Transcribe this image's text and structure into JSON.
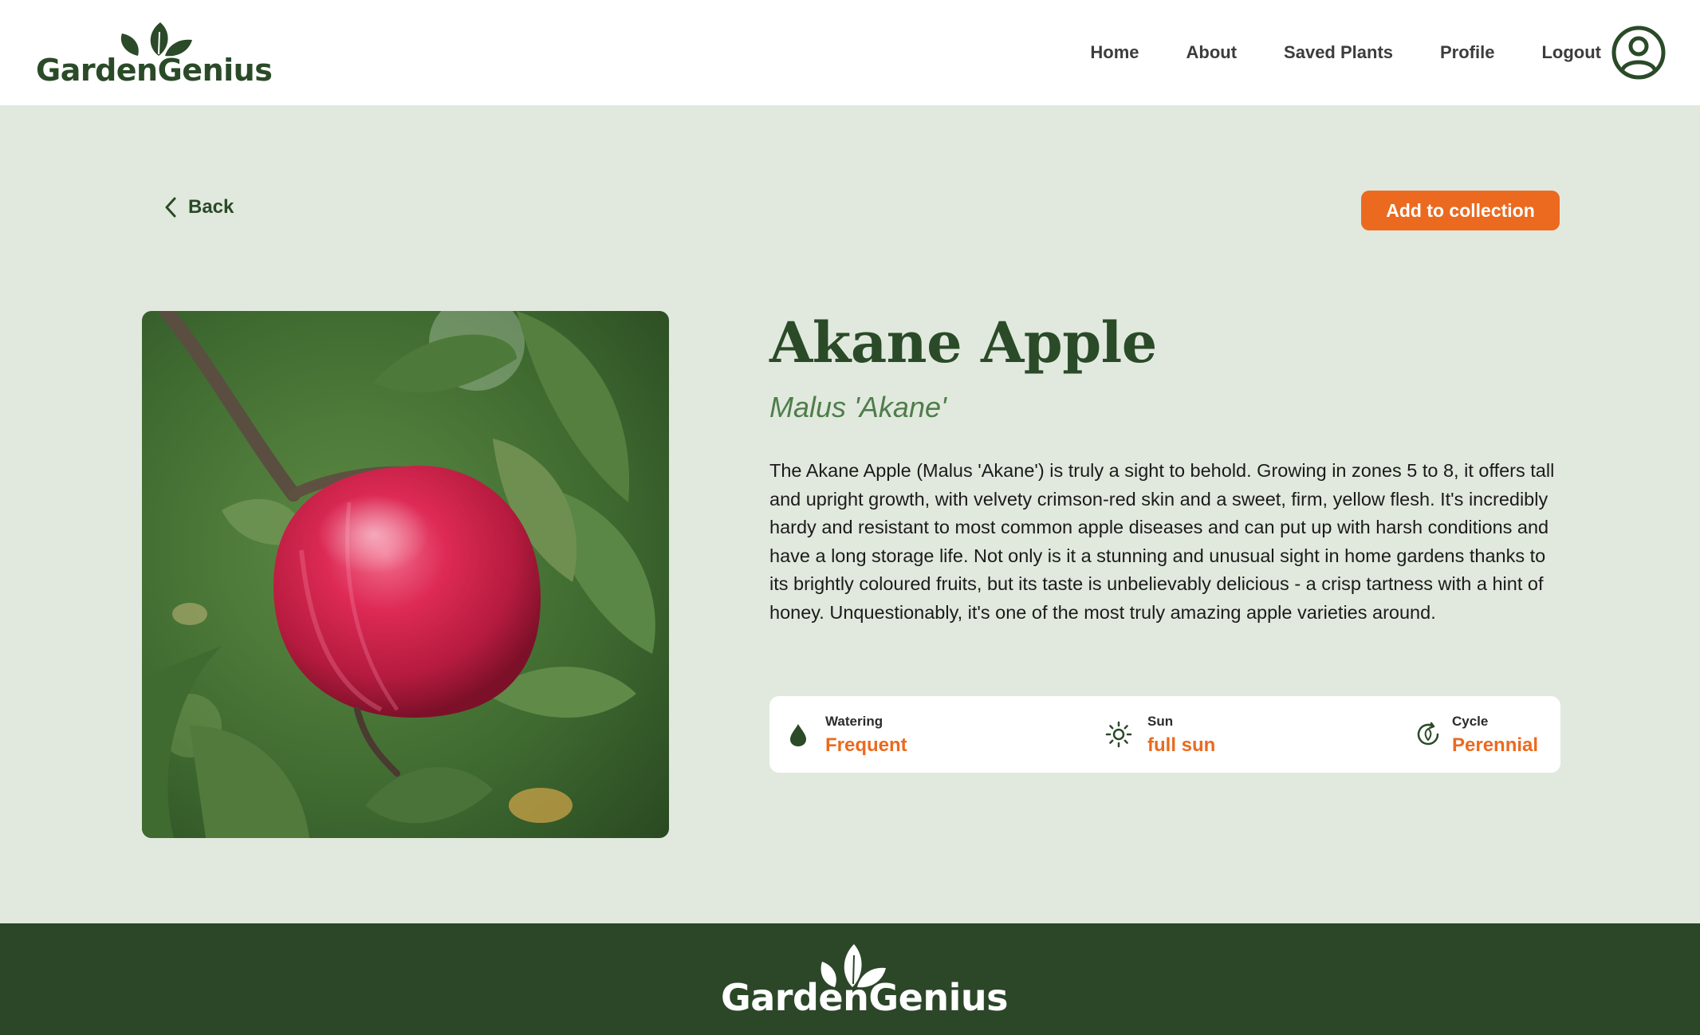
{
  "brand": {
    "name": "GardenGenius",
    "name_part1": "Garden",
    "name_part2": "Genius",
    "primary_color": "#2a4a28",
    "accent_color": "#eb6a1f",
    "background_color": "#e1e9de"
  },
  "nav": {
    "items": [
      {
        "label": "Home"
      },
      {
        "label": "About"
      },
      {
        "label": "Saved Plants"
      },
      {
        "label": "Profile"
      },
      {
        "label": "Logout"
      }
    ],
    "account_icon": "user-circle-icon"
  },
  "toolbar": {
    "back_label": "Back",
    "add_label": "Add to collection"
  },
  "plant": {
    "name": "Akane Apple",
    "scientific_name": "Malus 'Akane'",
    "description": "The Akane Apple (Malus 'Akane') is truly a sight to behold. Growing in zones 5 to 8, it offers tall and upright growth, with velvety crimson-red skin and a sweet, firm, yellow flesh. It's incredibly hardy and resistant to most common apple diseases and can put up with harsh conditions and have a long storage life. Not only is it a stunning and unusual sight in home gardens thanks to its brightly coloured fruits, but its taste is unbelievably delicious - a crisp tartness with a hint of honey. Unquestionably, it's one of the most truly amazing apple varieties around.",
    "image_icon": "apple-photo"
  },
  "care": {
    "watering": {
      "label": "Watering",
      "value": "Frequent",
      "icon": "water-drop-icon"
    },
    "sun": {
      "label": "Sun",
      "value": "full sun",
      "icon": "sun-icon"
    },
    "cycle": {
      "label": "Cycle",
      "value": "Perennial",
      "icon": "cycle-leaf-icon"
    }
  }
}
